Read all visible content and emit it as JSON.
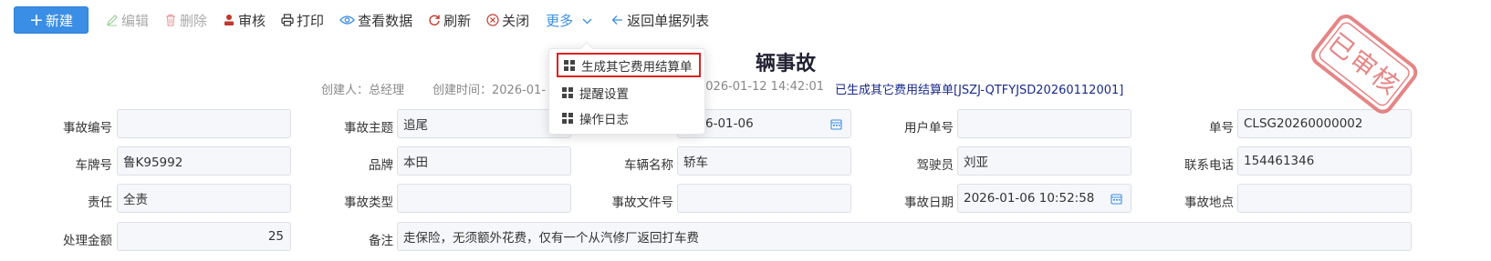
{
  "toolbar": {
    "new_label": "新建",
    "edit_label": "编辑",
    "delete_label": "删除",
    "audit_label": "审核",
    "print_label": "打印",
    "view_data_label": "查看数据",
    "refresh_label": "刷新",
    "close_label": "关闭",
    "more_label": "更多",
    "back_label": "返回单据列表"
  },
  "title": "辆事故",
  "meta": {
    "creator": "创建人：总经理",
    "created_time": "创建时间：2026-01-",
    "updated_time": "2026-01-12 14:42:01",
    "generated_doc": "已生成其它费用结算单[JSZJ-QTFYJSD20260112001]"
  },
  "dropdown": {
    "items": [
      {
        "label": "生成其它费用结算单"
      },
      {
        "label": "提醒设置"
      },
      {
        "label": "操作日志"
      }
    ]
  },
  "stamp": {
    "text": "已审核"
  },
  "form": {
    "row1": {
      "accident_no_label": "事故编号",
      "accident_no": "",
      "subject_label": "事故主题",
      "subject": "追尾",
      "date_partial": "6-01-06",
      "user_no_label": "用户单号",
      "user_no": "",
      "doc_no_label": "单号",
      "doc_no": "CLSG20260000002"
    },
    "row2": {
      "plate_label": "车牌号",
      "plate": "鲁K95992",
      "brand_label": "品牌",
      "brand": "本田",
      "vehicle_name_label": "车辆名称",
      "vehicle_name": "轿车",
      "driver_label": "驾驶员",
      "driver": "刘亚",
      "phone_label": "联系电话",
      "phone": "154461346"
    },
    "row3": {
      "responsibility_label": "责任",
      "responsibility": "全责",
      "accident_type_label": "事故类型",
      "accident_type": "",
      "file_no_label": "事故文件号",
      "file_no": "",
      "accident_date_label": "事故日期",
      "accident_date": "2026-01-06 10:52:58",
      "location_label": "事故地点",
      "location": ""
    },
    "row4": {
      "amount_label": "处理金额",
      "amount": "25",
      "remark_label": "备注",
      "remark": "走保险，无须额外花费，仅有一个从汽修厂返回打车费"
    }
  }
}
